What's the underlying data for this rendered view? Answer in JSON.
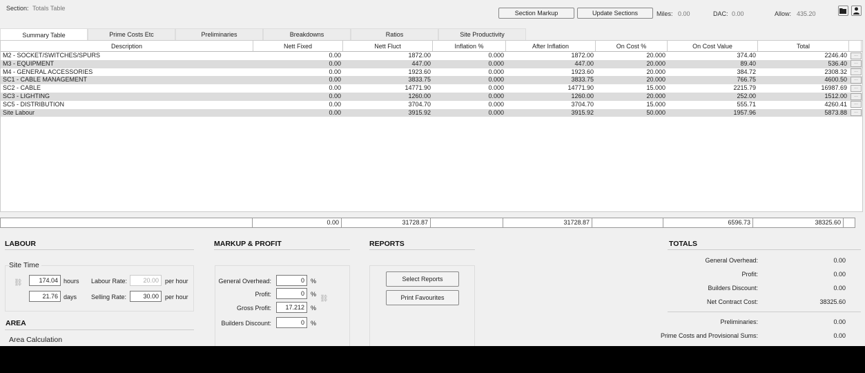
{
  "header": {
    "section_label": "Section:",
    "section_value": "Totals Table",
    "section_markup": "Section Markup",
    "update_sections": "Update Sections",
    "miles_label": "Miles:",
    "miles_value": "0.00",
    "dac_label": "DAC:",
    "dac_value": "0.00",
    "allow_label": "Allow:",
    "allow_value": "435.20"
  },
  "tabs": [
    "Summary Table",
    "Prime Costs Etc",
    "Preliminaries",
    "Breakdowns",
    "Ratios",
    "Site Productivity"
  ],
  "columns": [
    "Description",
    "Nett Fixed",
    "Nett Fluct",
    "Inflation %",
    "After Inflation",
    "On Cost %",
    "On Cost Value",
    "Total"
  ],
  "rows": [
    [
      "M2 - SOCKET/SWITCHES/SPURS",
      "0.00",
      "1872.00",
      "0.000",
      "1872.00",
      "20.000",
      "374.40",
      "2246.40"
    ],
    [
      "M3 - EQUIPMENT",
      "0.00",
      "447.00",
      "0.000",
      "447.00",
      "20.000",
      "89.40",
      "536.40"
    ],
    [
      "M4 - GENERAL ACCESSORIES",
      "0.00",
      "1923.60",
      "0.000",
      "1923.60",
      "20.000",
      "384.72",
      "2308.32"
    ],
    [
      "SC1 - CABLE MANAGEMENT",
      "0.00",
      "3833.75",
      "0.000",
      "3833.75",
      "20.000",
      "766.75",
      "4600.50"
    ],
    [
      "SC2 - CABLE",
      "0.00",
      "14771.90",
      "0.000",
      "14771.90",
      "15.000",
      "2215.79",
      "16987.69"
    ],
    [
      "SC3 - LIGHTING",
      "0.00",
      "1260.00",
      "0.000",
      "1260.00",
      "20.000",
      "252.00",
      "1512.00"
    ],
    [
      "SC5 - DISTRIBUTION",
      "0.00",
      "3704.70",
      "0.000",
      "3704.70",
      "15.000",
      "555.71",
      "4260.41"
    ],
    [
      "Site Labour",
      "0.00",
      "3915.92",
      "0.000",
      "3915.92",
      "50.000",
      "1957.96",
      "5873.88"
    ]
  ],
  "row_button": "...",
  "totals_row": [
    "",
    "0.00",
    "31728.87",
    "",
    "31728.87",
    "",
    "6596.73",
    "38325.60"
  ],
  "labour": {
    "title": "LABOUR",
    "site_time": "Site Time",
    "hours": "174.04",
    "hours_unit": "hours",
    "days": "21.76",
    "days_unit": "days",
    "labour_rate_label": "Labour Rate:",
    "labour_rate": "20.00",
    "selling_rate_label": "Selling Rate:",
    "selling_rate": "30.00",
    "per_hour": "per hour"
  },
  "area": {
    "title": "AREA",
    "calc": "Area Calculation"
  },
  "markup": {
    "title": "MARKUP & PROFIT",
    "general_overhead_label": "General Overhead:",
    "general_overhead": "0",
    "profit_label": "Profit:",
    "profit": "0",
    "gross_profit_label": "Gross Profit:",
    "gross_profit": "17.212",
    "builders_discount_label": "Builders Discount:",
    "builders_discount": "0",
    "pct": "%"
  },
  "reports": {
    "title": "REPORTS",
    "select": "Select Reports",
    "print": "Print Favourites"
  },
  "totals": {
    "title": "TOTALS",
    "items": [
      {
        "label": "General Overhead:",
        "value": "0.00"
      },
      {
        "label": "Profit:",
        "value": "0.00"
      },
      {
        "label": "Builders Discount:",
        "value": "0.00"
      },
      {
        "label": "Net Contract Cost:",
        "value": "38325.60"
      }
    ],
    "items2": [
      {
        "label": "Preliminaries:",
        "value": "0.00"
      },
      {
        "label": "Prime Costs and Provisional Sums:",
        "value": "0.00"
      }
    ]
  }
}
